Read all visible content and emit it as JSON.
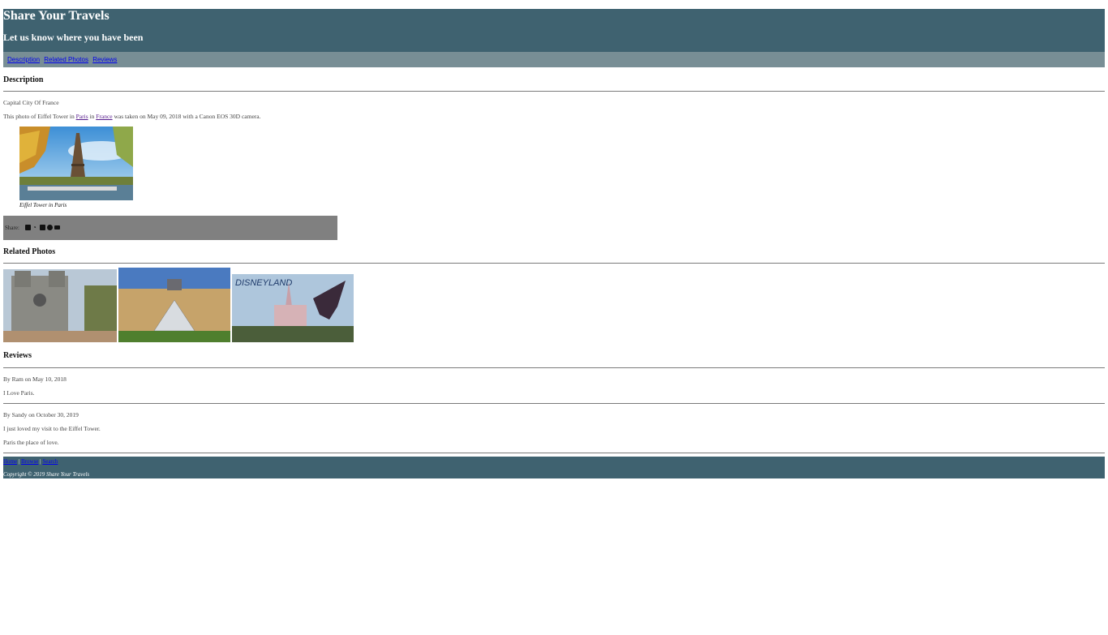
{
  "header": {
    "title": "Share Your Travels",
    "subtitle": "Let us know where you have been"
  },
  "nav": {
    "items": [
      "Description",
      "Related Photos",
      "Reviews"
    ]
  },
  "description": {
    "heading": "Description",
    "subtitle": "Capital City Of France",
    "sentence_prefix": "This photo of Eiffel Tower in ",
    "city": "Paris",
    "in_word": " in ",
    "country": "France",
    "sentence_suffix": " was taken on May 09, 2018 with a Canon EOS 30D camera.",
    "caption": "Eiffel Tower in Paris"
  },
  "share": {
    "label": "Share:",
    "icons": [
      "envelope-icon",
      "rss-icon",
      "twitter-icon",
      "facebook-icon",
      "flickr-icon"
    ]
  },
  "related": {
    "heading": "Related Photos"
  },
  "reviews": {
    "heading": "Reviews",
    "items": [
      {
        "byline": "By Ram on May 10, 2018",
        "lines": [
          "I Love Paris."
        ]
      },
      {
        "byline": "By Sandy on October 30, 2019",
        "lines": [
          "I just loved my visit to the Eiffel Tower.",
          "Paris the place of love."
        ]
      }
    ]
  },
  "footer": {
    "links": [
      "Home",
      "Browse",
      "Search"
    ],
    "separator": "|",
    "copyright": "Copyright © 2019 Share Your Travels"
  },
  "colors": {
    "header_bg": "#3f6270",
    "nav_bg": "#788e95",
    "share_bg": "#808080"
  }
}
